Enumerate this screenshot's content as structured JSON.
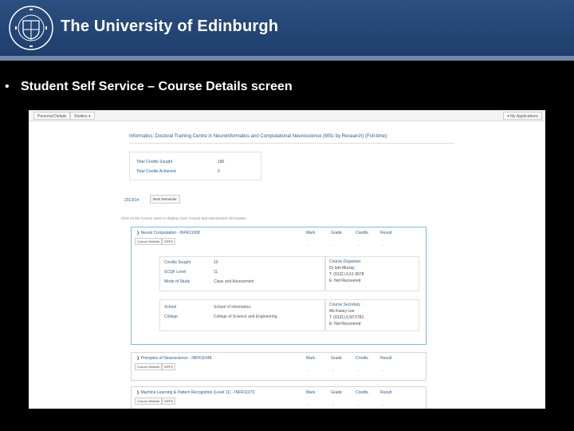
{
  "header": {
    "title": "The University of Edinburgh",
    "crest_icon": "university-crest-icon",
    "background": "#254773"
  },
  "bullet": {
    "marker": "•",
    "text": "Student Self Service – Course Details screen"
  },
  "screenshot": {
    "nav": {
      "tab_personal": "Personal Details",
      "tab_studies": "Studies ▾",
      "tab_applications": "▾ My Applications"
    },
    "programme_title": "Informatics: Doctoral Training Centre in Neuroinformatics and Computational Neuroscience (MSc by Research) (Full-time)",
    "credits": {
      "sought_label": "Total Credits Sought",
      "sought_value": "180",
      "achieved_label": "Total Credits Achieved",
      "achieved_value": "0"
    },
    "year": {
      "label": "2013/14",
      "button": "Next Semester"
    },
    "info_line": "Click on the Course name to display more Course and assessment information",
    "columns": {
      "mark": "Mark",
      "grade": "Grade",
      "credits": "Credits",
      "result": "Result"
    },
    "course_buttons": {
      "website": "Course Website",
      "drps": "DRPS"
    },
    "courses": [
      {
        "title": "❯ Neural Computation - INFR11008",
        "mark": "-",
        "grade": "-",
        "credits": "-",
        "result": "-",
        "details": {
          "credits_sought_label": "Credits Sought",
          "credits_sought_value": "10",
          "scqf_label": "SCQF Level",
          "scqf_value": "11",
          "mode_label": "Mode of Study",
          "mode_value": "Class and Assessment",
          "school_label": "School",
          "school_value": "School of Informatics",
          "college_label": "College",
          "college_value": "College of Science and Engineering"
        },
        "organiser": {
          "heading": "Course Organiser",
          "name": "Dr Iain Murray",
          "phone": "T: (0131) 6,51 9078",
          "email": "E: Not Recovered"
        },
        "secretary": {
          "heading": "Course Secretary",
          "name": "Ms Kasey Lee",
          "phone": "T: (0131) 6,50 5781",
          "email": "E: Not Recovered"
        }
      },
      {
        "title": "❯ Principles of Neuroscience - INFR11048",
        "mark": "-",
        "grade": "-",
        "credits": "-",
        "result": "-"
      },
      {
        "title": "❯ Machine Learning & Pattern Recognition (Level 11) - INFR11073",
        "mark": "-",
        "grade": "-",
        "credits": "-",
        "result": "-"
      }
    ]
  }
}
